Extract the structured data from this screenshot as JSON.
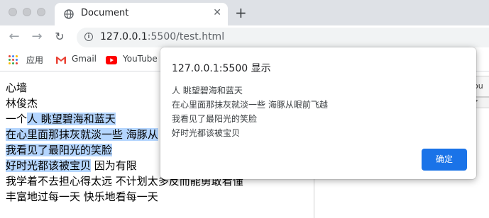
{
  "browser": {
    "tab_title": "Document",
    "url_host": "127.0.0.1",
    "url_port_path": ":5500/test.html"
  },
  "bookmarks": {
    "apps_label": "应用",
    "gmail_label": "Gmail",
    "youtube_label": "YouTube"
  },
  "devtools": {
    "partial_label": "ou"
  },
  "page": {
    "lines": [
      {
        "text": "心墙"
      },
      {
        "text": "林俊杰"
      },
      {
        "pre": "一个",
        "sel": "人 眺望碧海和蓝天",
        "post": ""
      },
      {
        "pre": "",
        "sel": "在心里面那抹灰就淡一些 海豚从",
        "post": ""
      },
      {
        "pre": "",
        "sel": "我看见了最阳光的笑脸",
        "post": ""
      },
      {
        "pre": "",
        "sel": "好时光都该被宝贝",
        "post": " 因为有限"
      },
      {
        "text": "我学着不去担心得太远 不计划太多反而能勇敢看懂"
      },
      {
        "text": "丰富地过每一天 快乐地看每一天"
      }
    ]
  },
  "dialog": {
    "title": "127.0.0.1:5500 显示",
    "message_lines": [
      "人 眺望碧海和蓝天",
      "在心里面那抹灰就淡一些 海豚从眼前飞越",
      "我看见了最阳光的笑脸",
      "好时光都该被宝贝"
    ],
    "ok_label": "确定",
    "ok_color": "#1a73e8"
  }
}
